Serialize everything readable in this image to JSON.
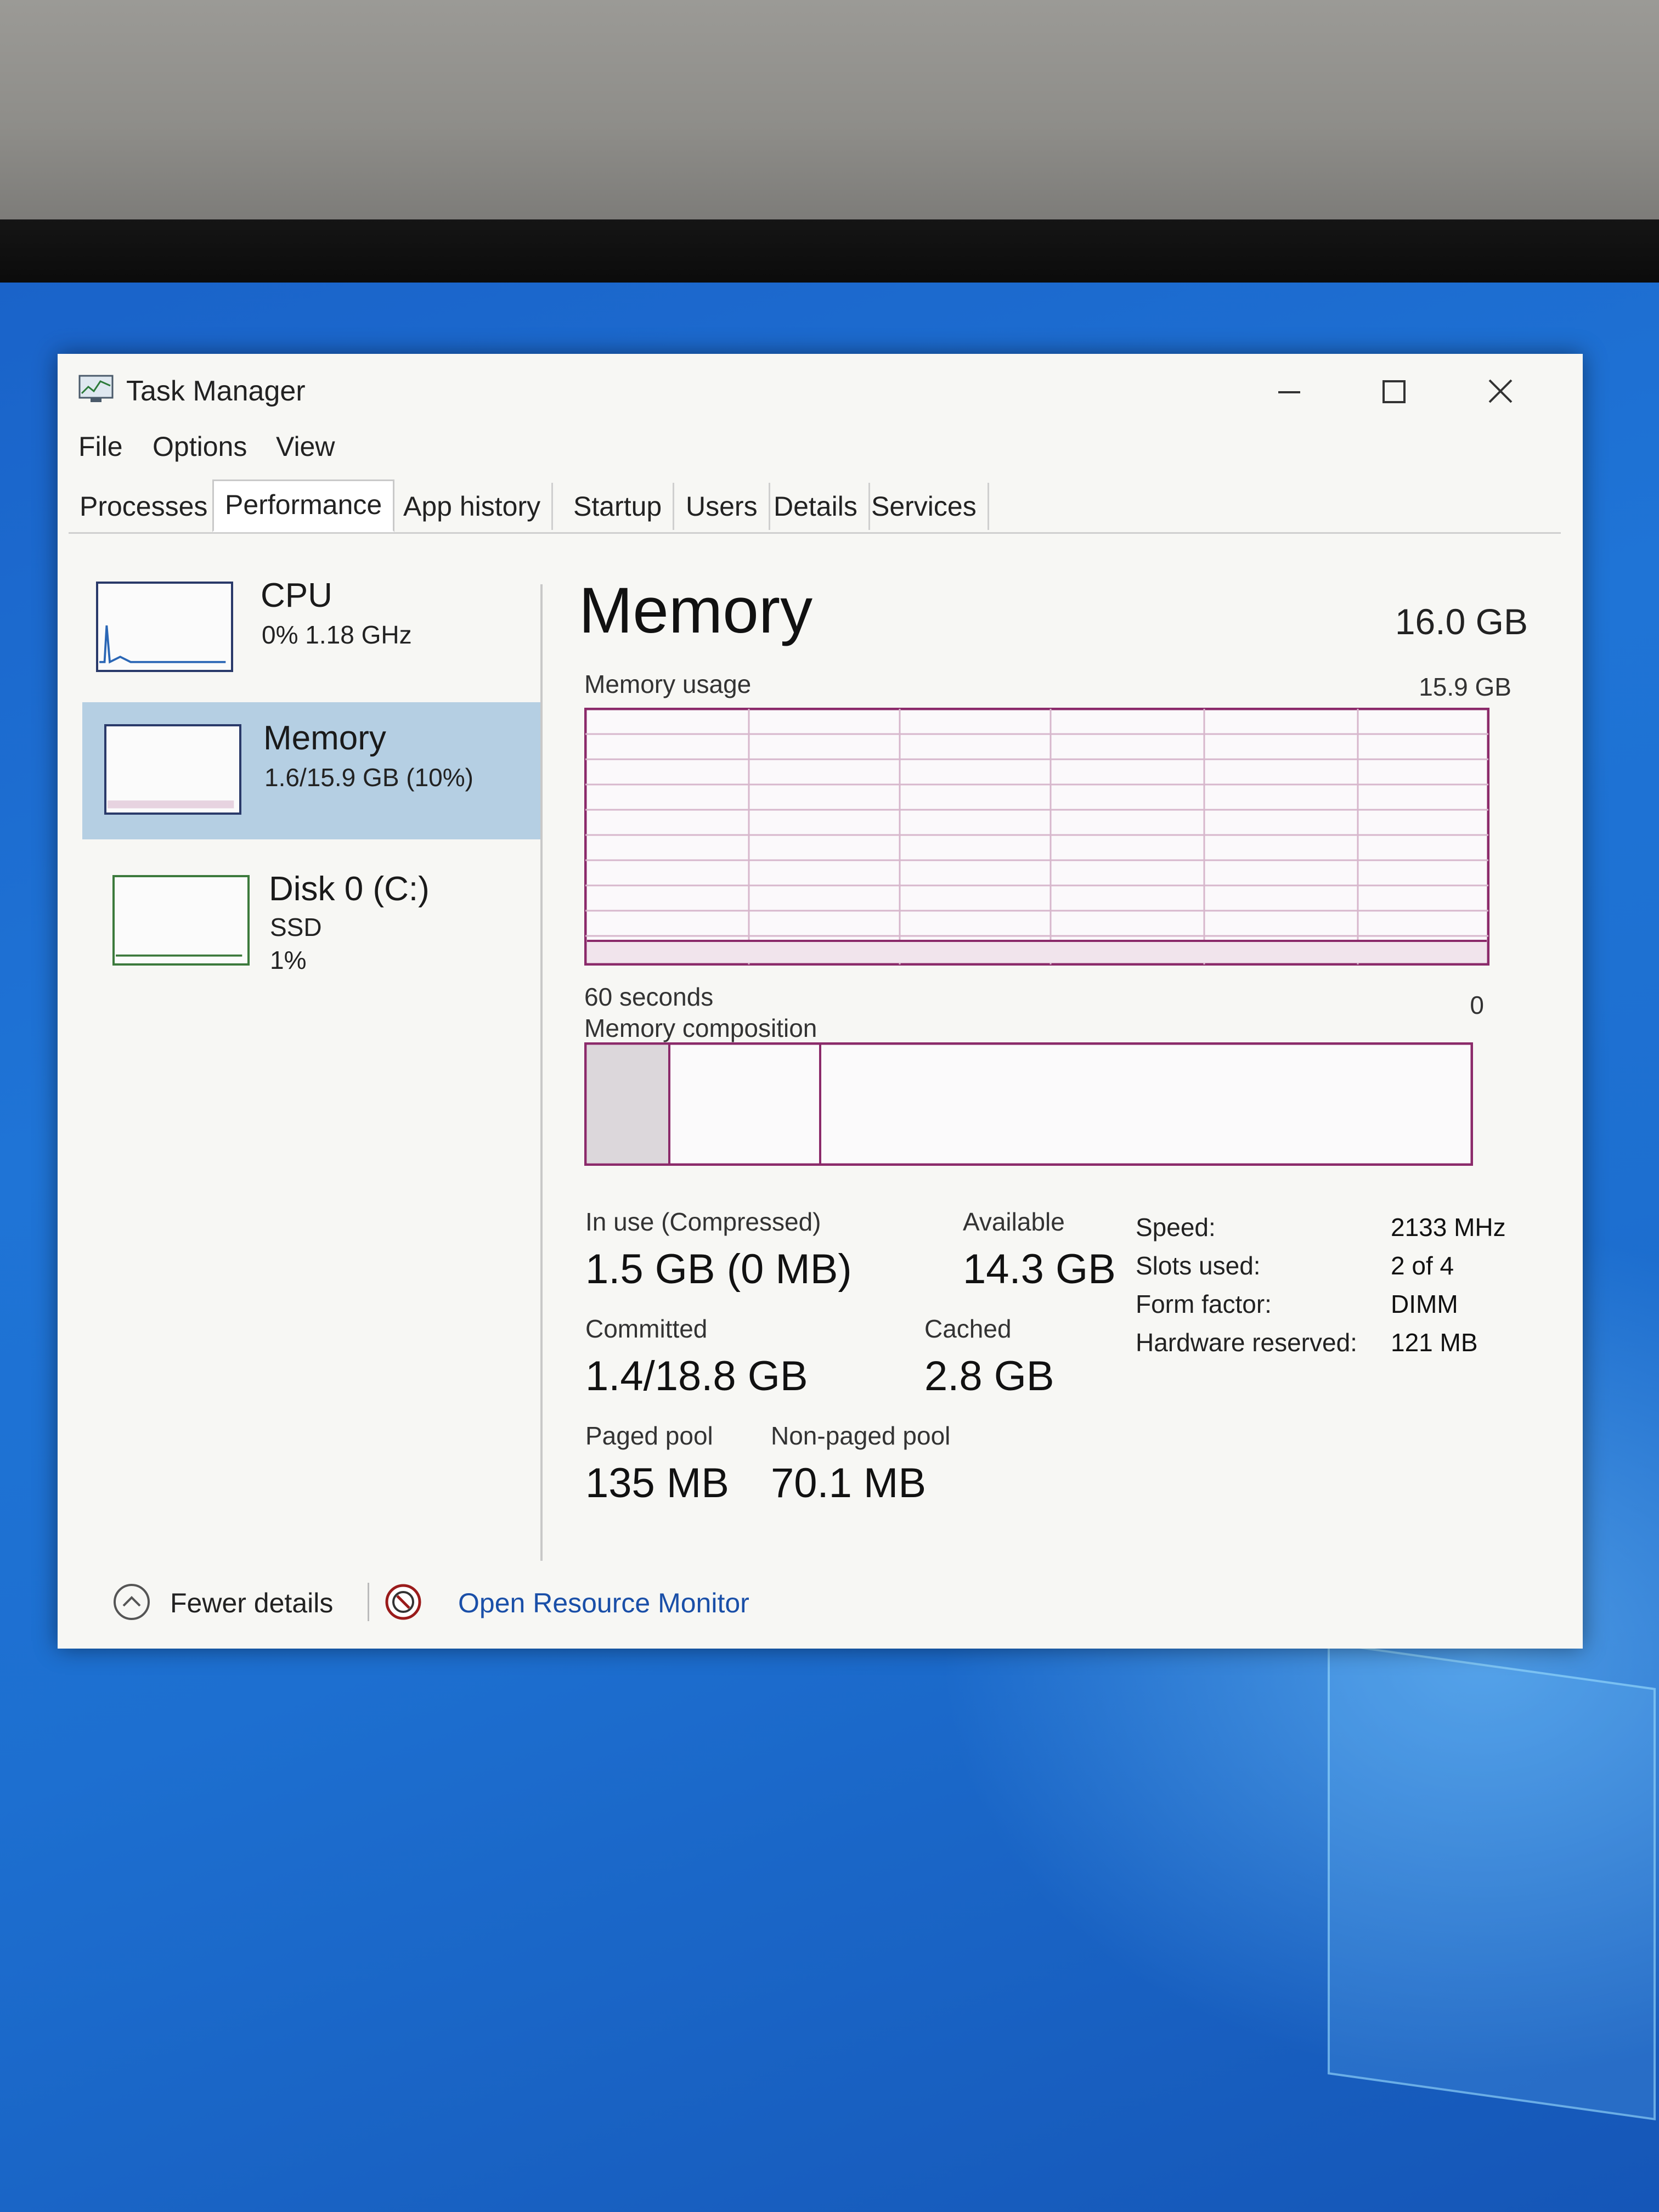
{
  "window": {
    "title": "Task Manager",
    "controls": [
      "minimize-icon",
      "maximize-icon",
      "close-icon"
    ]
  },
  "menu": [
    "File",
    "Options",
    "View"
  ],
  "tabs": [
    "Processes",
    "Performance",
    "App history",
    "Startup",
    "Users",
    "Details",
    "Services"
  ],
  "active_tab": "Performance",
  "sidebar": {
    "items": [
      {
        "name": "CPU",
        "line1": "0%  1.18 GHz",
        "line2": ""
      },
      {
        "name": "Memory",
        "line1": "1.6/15.9 GB (10%)",
        "line2": ""
      },
      {
        "name": "Disk 0 (C:)",
        "line1": "SSD",
        "line2": "1%"
      }
    ],
    "active": "Memory"
  },
  "memory": {
    "title": "Memory",
    "total": "16.0 GB",
    "usage_label": "Memory usage",
    "usage_max": "15.9 GB",
    "time_left": "60 seconds",
    "time_right": "0",
    "composition_label": "Memory composition",
    "stats": {
      "in_use_label": "In use (Compressed)",
      "in_use_value": "1.5 GB (0 MB)",
      "available_label": "Available",
      "available_value": "14.3 GB",
      "committed_label": "Committed",
      "committed_value": "1.4/18.8 GB",
      "cached_label": "Cached",
      "cached_value": "2.8 GB",
      "paged_label": "Paged pool",
      "paged_value": "135 MB",
      "nonpaged_label": "Non-paged pool",
      "nonpaged_value": "70.1 MB"
    },
    "details": [
      {
        "key": "Speed:",
        "value": "2133 MHz"
      },
      {
        "key": "Slots used:",
        "value": "2 of 4"
      },
      {
        "key": "Form factor:",
        "value": "DIMM"
      },
      {
        "key": "Hardware reserved:",
        "value": "121 MB"
      }
    ]
  },
  "footer": {
    "fewer_details": "Fewer details",
    "resource_monitor": "Open Resource Monitor"
  },
  "colors": {
    "graph_border": "#8b2a6a",
    "graph_grid": "#d7b7cc",
    "link": "#1a4fa8",
    "selected_item": "#b5cfe3"
  }
}
